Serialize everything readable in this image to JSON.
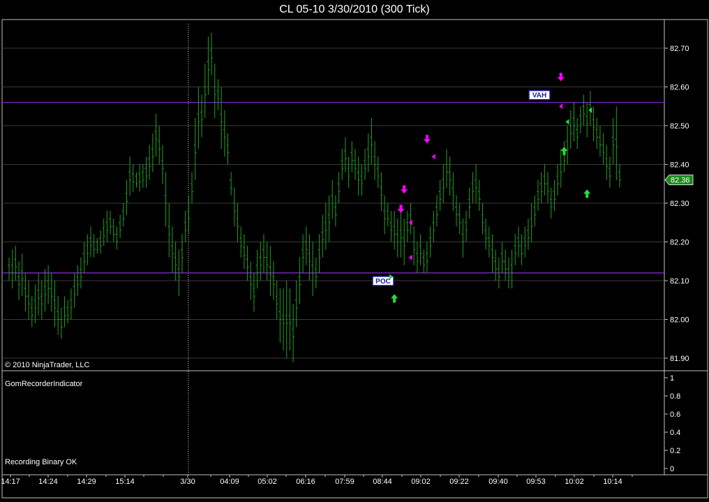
{
  "window": {
    "title": "CL 05-10  3/30/2010 (300 Tick)"
  },
  "copyright": "© 2010 NinjaTrader, LLC",
  "indicator_panel": {
    "name": "GomRecorderIndicator",
    "status": "Recording Binary OK",
    "yticks": [
      "1",
      "0.8",
      "0.6",
      "0.4",
      "0.2",
      "0"
    ]
  },
  "price_box": {
    "value": "82.36",
    "bg": "#1a8a1a"
  },
  "levels": [
    {
      "label": "VAH",
      "value": 82.56
    },
    {
      "label": "POC",
      "value": 82.12
    }
  ],
  "colors": {
    "bar": "#22a022",
    "level": "#8a2be2",
    "down_arrow": "#ff00ff",
    "up_arrow": "#22dd44",
    "grid": "#3a3a3a"
  },
  "chart_data": {
    "type": "bar",
    "subtype": "tick-range-bars",
    "ylim": [
      81.88,
      82.78
    ],
    "yticks": [
      "82.70",
      "82.60",
      "82.50",
      "82.40",
      "82.30",
      "82.20",
      "82.10",
      "82.00",
      "81.90"
    ],
    "xticks": [
      "14:17",
      "14:24",
      "14:29",
      "15:14",
      "3/30",
      "04:09",
      "05:02",
      "06:16",
      "07:59",
      "08:44",
      "09:02",
      "09:22",
      "09:40",
      "09:53",
      "10:02",
      "10:14"
    ],
    "session_break": "3/30",
    "last_price": 82.36,
    "bars": [
      [
        82.16,
        82.1
      ],
      [
        82.18,
        82.08
      ],
      [
        82.19,
        82.1
      ],
      [
        82.15,
        82.05
      ],
      [
        82.17,
        82.06
      ],
      [
        82.12,
        82.02
      ],
      [
        82.1,
        82.0
      ],
      [
        82.06,
        81.98
      ],
      [
        82.09,
        81.99
      ],
      [
        82.12,
        82.01
      ],
      [
        82.1,
        82.0
      ],
      [
        82.13,
        82.02
      ],
      [
        82.14,
        82.04
      ],
      [
        82.12,
        82.02
      ],
      [
        82.1,
        81.98
      ],
      [
        82.06,
        81.96
      ],
      [
        82.03,
        81.95
      ],
      [
        82.06,
        81.98
      ],
      [
        82.05,
        81.99
      ],
      [
        82.08,
        82.0
      ],
      [
        82.12,
        82.03
      ],
      [
        82.14,
        82.06
      ],
      [
        82.16,
        82.08
      ],
      [
        82.2,
        82.12
      ],
      [
        82.22,
        82.14
      ],
      [
        82.24,
        82.16
      ],
      [
        82.22,
        82.16
      ],
      [
        82.21,
        82.17
      ],
      [
        82.23,
        82.17
      ],
      [
        82.26,
        82.19
      ],
      [
        82.28,
        82.2
      ],
      [
        82.28,
        82.22
      ],
      [
        82.26,
        82.2
      ],
      [
        82.24,
        82.18
      ],
      [
        82.27,
        82.21
      ],
      [
        82.3,
        82.24
      ],
      [
        82.36,
        82.27
      ],
      [
        82.42,
        82.32
      ],
      [
        82.4,
        82.33
      ],
      [
        82.38,
        82.34
      ],
      [
        82.4,
        82.33
      ],
      [
        82.4,
        82.34
      ],
      [
        82.42,
        82.34
      ],
      [
        82.45,
        82.36
      ],
      [
        82.48,
        82.38
      ],
      [
        82.53,
        82.42
      ],
      [
        82.5,
        82.4
      ],
      [
        82.45,
        82.35
      ],
      [
        82.38,
        82.24
      ],
      [
        82.3,
        82.16
      ],
      [
        82.24,
        82.12
      ],
      [
        82.2,
        82.1
      ],
      [
        82.18,
        82.06
      ],
      [
        82.22,
        82.12
      ],
      [
        82.28,
        82.2
      ],
      [
        82.32,
        82.22
      ],
      [
        82.38,
        82.3
      ],
      [
        82.52,
        82.36
      ],
      [
        82.6,
        82.44
      ],
      [
        82.58,
        82.47
      ],
      [
        82.66,
        82.52
      ],
      [
        82.73,
        82.58
      ],
      [
        82.74,
        82.63
      ],
      [
        82.66,
        82.52
      ],
      [
        82.62,
        82.54
      ],
      [
        82.6,
        82.44
      ],
      [
        82.54,
        82.42
      ],
      [
        82.48,
        82.4
      ],
      [
        82.38,
        82.32
      ],
      [
        82.34,
        82.24
      ],
      [
        82.3,
        82.2
      ],
      [
        82.24,
        82.16
      ],
      [
        82.22,
        82.13
      ],
      [
        82.19,
        82.1
      ],
      [
        82.15,
        82.05
      ],
      [
        82.12,
        82.02
      ],
      [
        82.18,
        82.08
      ],
      [
        82.2,
        82.1
      ],
      [
        82.22,
        82.12
      ],
      [
        82.2,
        82.1
      ],
      [
        82.19,
        82.06
      ],
      [
        82.15,
        82.05
      ],
      [
        82.1,
        82.0
      ],
      [
        82.08,
        81.94
      ],
      [
        82.08,
        81.92
      ],
      [
        82.1,
        81.9
      ],
      [
        82.08,
        81.92
      ],
      [
        82.04,
        81.89
      ],
      [
        82.1,
        81.98
      ],
      [
        82.16,
        82.04
      ],
      [
        82.22,
        82.12
      ],
      [
        82.24,
        82.14
      ],
      [
        82.22,
        82.1
      ],
      [
        82.2,
        82.06
      ],
      [
        82.16,
        82.08
      ],
      [
        82.22,
        82.12
      ],
      [
        82.27,
        82.16
      ],
      [
        82.3,
        82.18
      ],
      [
        82.32,
        82.2
      ],
      [
        82.36,
        82.26
      ],
      [
        82.32,
        82.24
      ],
      [
        82.38,
        82.3
      ],
      [
        82.44,
        82.36
      ],
      [
        82.47,
        82.38
      ],
      [
        82.42,
        82.34
      ],
      [
        82.46,
        82.38
      ],
      [
        82.44,
        82.36
      ],
      [
        82.42,
        82.32
      ],
      [
        82.4,
        82.32
      ],
      [
        82.44,
        82.36
      ],
      [
        82.48,
        82.38
      ],
      [
        82.52,
        82.4
      ],
      [
        82.46,
        82.36
      ],
      [
        82.42,
        82.34
      ],
      [
        82.38,
        82.28
      ],
      [
        82.32,
        82.22
      ],
      [
        82.3,
        82.24
      ],
      [
        82.28,
        82.2
      ],
      [
        82.28,
        82.18
      ],
      [
        82.26,
        82.16
      ],
      [
        82.28,
        82.16
      ],
      [
        82.26,
        82.14
      ],
      [
        82.28,
        82.2
      ],
      [
        82.3,
        82.22
      ],
      [
        82.24,
        82.14
      ],
      [
        82.2,
        82.12
      ],
      [
        82.22,
        82.14
      ],
      [
        82.18,
        82.12
      ],
      [
        82.2,
        82.12
      ],
      [
        82.24,
        82.16
      ],
      [
        82.28,
        82.2
      ],
      [
        82.32,
        82.24
      ],
      [
        82.36,
        82.28
      ],
      [
        82.4,
        82.3
      ],
      [
        82.44,
        82.34
      ],
      [
        82.42,
        82.32
      ],
      [
        82.38,
        82.28
      ],
      [
        82.32,
        82.24
      ],
      [
        82.3,
        82.22
      ],
      [
        82.26,
        82.16
      ],
      [
        82.28,
        82.2
      ],
      [
        82.34,
        82.26
      ],
      [
        82.38,
        82.3
      ],
      [
        82.4,
        82.3
      ],
      [
        82.36,
        82.28
      ],
      [
        82.3,
        82.22
      ],
      [
        82.26,
        82.18
      ],
      [
        82.24,
        82.16
      ],
      [
        82.22,
        82.12
      ],
      [
        82.18,
        82.1
      ],
      [
        82.16,
        82.08
      ],
      [
        82.2,
        82.12
      ],
      [
        82.18,
        82.1
      ],
      [
        82.16,
        82.08
      ],
      [
        82.18,
        82.08
      ],
      [
        82.22,
        82.14
      ],
      [
        82.24,
        82.16
      ],
      [
        82.22,
        82.14
      ],
      [
        82.24,
        82.16
      ],
      [
        82.26,
        82.18
      ],
      [
        82.3,
        82.2
      ],
      [
        82.32,
        82.24
      ],
      [
        82.36,
        82.28
      ],
      [
        82.38,
        82.3
      ],
      [
        82.4,
        82.32
      ],
      [
        82.38,
        82.3
      ],
      [
        82.34,
        82.26
      ],
      [
        82.36,
        82.28
      ],
      [
        82.4,
        82.32
      ],
      [
        82.44,
        82.34
      ],
      [
        82.46,
        82.38
      ],
      [
        82.5,
        82.4
      ],
      [
        82.54,
        82.44
      ],
      [
        82.56,
        82.46
      ],
      [
        82.52,
        82.44
      ],
      [
        82.55,
        82.48
      ],
      [
        82.58,
        82.5
      ],
      [
        82.56,
        82.47
      ],
      [
        82.59,
        82.5
      ],
      [
        82.55,
        82.46
      ],
      [
        82.52,
        82.44
      ],
      [
        82.5,
        82.42
      ],
      [
        82.48,
        82.4
      ],
      [
        82.45,
        82.36
      ],
      [
        82.42,
        82.34
      ],
      [
        82.52,
        82.4
      ],
      [
        82.55,
        82.36
      ],
      [
        82.4,
        82.34
      ]
    ],
    "down_arrows": [
      {
        "bar": 120,
        "price": 82.28
      },
      {
        "bar": 121,
        "price": 82.33
      },
      {
        "bar": 128,
        "price": 82.46
      },
      {
        "bar": 169,
        "price": 82.62
      }
    ],
    "up_arrows": [
      {
        "bar": 118,
        "price": 82.06
      },
      {
        "bar": 170,
        "price": 82.44
      },
      {
        "bar": 177,
        "price": 82.33
      }
    ],
    "left_markers": [
      {
        "bar": 122,
        "price": 82.16,
        "color": "down"
      },
      {
        "bar": 122,
        "price": 82.25,
        "color": "down"
      },
      {
        "bar": 129,
        "price": 82.42,
        "color": "down"
      },
      {
        "bar": 168,
        "price": 82.55,
        "color": "down"
      },
      {
        "bar": 170,
        "price": 82.51,
        "color": "up"
      },
      {
        "bar": 177,
        "price": 82.54,
        "color": "up"
      }
    ],
    "right_markers": [
      {
        "bar": 118,
        "price": 82.11,
        "color": "up"
      }
    ]
  }
}
